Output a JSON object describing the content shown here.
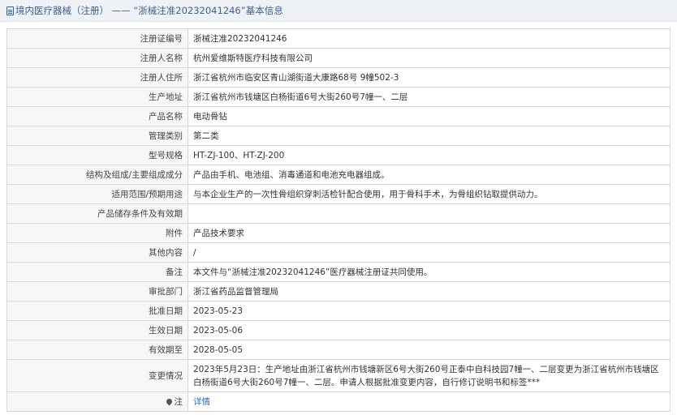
{
  "header": {
    "section": "境内医疗器械（注册）",
    "separator": "——",
    "title": "“浙械注准20232041246”基本信息"
  },
  "rows": [
    {
      "label": "注册证编号",
      "value": "浙械注准20232041246"
    },
    {
      "label": "注册人名称",
      "value": "杭州爱维斯特医疗科技有限公司"
    },
    {
      "label": "注册人住所",
      "value": "浙江省杭州市临安区青山湖街道大康路68号 9幢502-3"
    },
    {
      "label": "生产地址",
      "value": "浙江省杭州市钱塘区白杨街道6号大街260号7幢一、二层"
    },
    {
      "label": "产品名称",
      "value": "电动骨钻"
    },
    {
      "label": "管理类别",
      "value": "第二类"
    },
    {
      "label": "型号规格",
      "value": "HT-ZJ-100、HT-ZJ-200"
    },
    {
      "label": "结构及组成/主要组成成分",
      "value": "产品由手机、电池组、消毒通道和电池充电器组成。"
    },
    {
      "label": "适用范围/预期用途",
      "value": "与本企业生产的一次性骨组织穿刺活检针配合使用，用于骨科手术，为骨组织钻取提供动力。"
    },
    {
      "label": "产品储存条件及有效期",
      "value": ""
    },
    {
      "label": "附件",
      "value": "产品技术要求"
    },
    {
      "label": "其他内容",
      "value": "/"
    },
    {
      "label": "备注",
      "value": "本文件与“浙械注准20232041246”医疗器械注册证共同使用。"
    },
    {
      "label": "审批部门",
      "value": "浙江省药品监督管理局"
    },
    {
      "label": "批准日期",
      "value": "2023-05-23"
    },
    {
      "label": "生效日期",
      "value": "2023-05-06"
    },
    {
      "label": "有效期至",
      "value": "2028-05-05"
    },
    {
      "label": "变更情况",
      "value": "2023年5月23日：生产地址由浙江省杭州市钱塘新区6号大街260号正泰中自科技园7幢一、二层变更为浙江省杭州市钱塘区白杨街道6号大街260号7幢一、二层。申请人根据批准变更内容，自行修订说明书和标签***"
    }
  ],
  "note_row": {
    "label": "注",
    "link": "详情",
    "icon": "pin-icon"
  }
}
